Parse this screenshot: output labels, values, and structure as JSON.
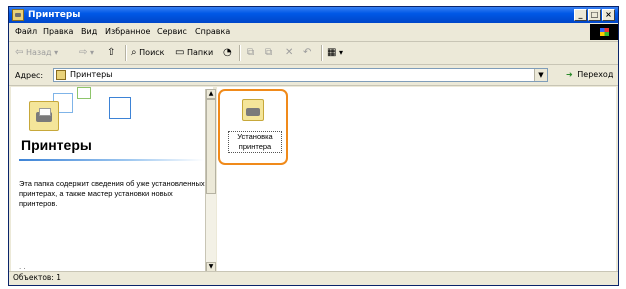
{
  "window": {
    "title": "Принтеры",
    "minimize": "_",
    "maximize": "□",
    "close": "×"
  },
  "menu": {
    "items": [
      {
        "label": "Файл"
      },
      {
        "label": "Правка"
      },
      {
        "label": "Вид"
      },
      {
        "label": "Избранное"
      },
      {
        "label": "Сервис"
      },
      {
        "label": "Справка"
      }
    ]
  },
  "toolbar": {
    "back_label": "Назад",
    "search_label": "Поиск",
    "folders_label": "Папки"
  },
  "address": {
    "label": "Адрес:",
    "value": "Принтеры",
    "go_label": "Переход"
  },
  "left_pane": {
    "title": "Принтеры",
    "description": "Эта папка содержит сведения об уже установленных принтерах, а также мастер установки новых принтеров."
  },
  "items": [
    {
      "label": "Установка принтера"
    }
  ],
  "status": {
    "text": "Объектов: 1"
  }
}
